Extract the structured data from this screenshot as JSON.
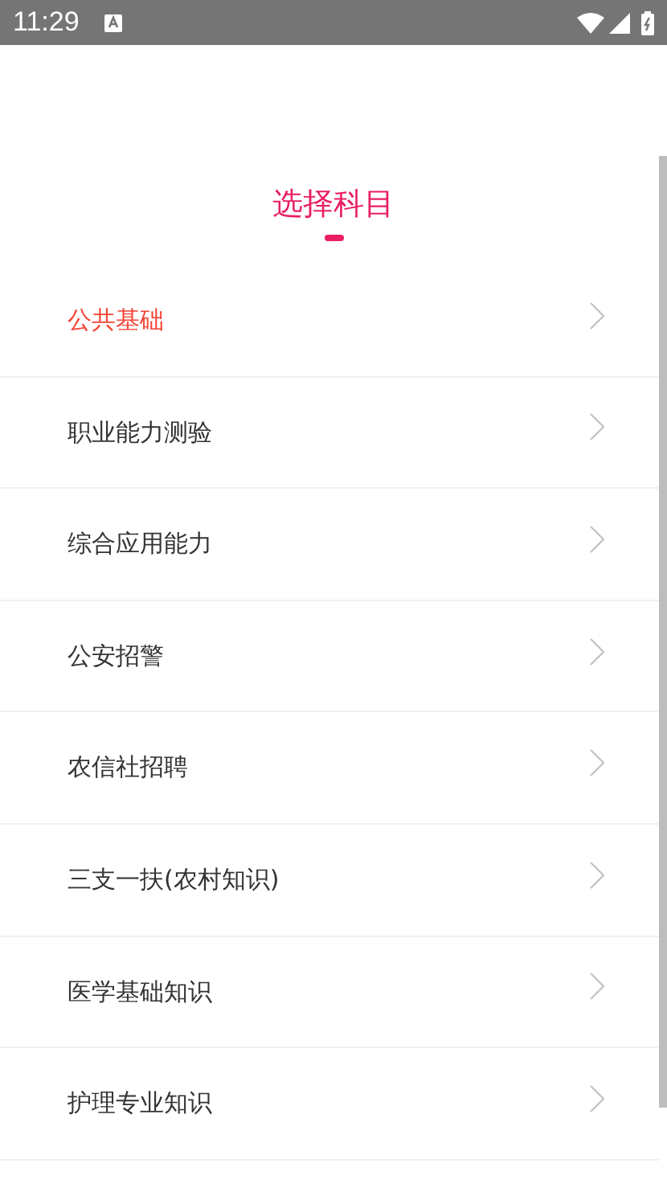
{
  "status_bar": {
    "time": "11:29"
  },
  "title": "选择科目",
  "subjects": [
    {
      "label": "公共基础",
      "selected": true
    },
    {
      "label": "职业能力测验",
      "selected": false
    },
    {
      "label": "综合应用能力",
      "selected": false
    },
    {
      "label": "公安招警",
      "selected": false
    },
    {
      "label": "农信社招聘",
      "selected": false
    },
    {
      "label": "三支一扶(农村知识)",
      "selected": false
    },
    {
      "label": "医学基础知识",
      "selected": false
    },
    {
      "label": "护理专业知识",
      "selected": false
    }
  ]
}
